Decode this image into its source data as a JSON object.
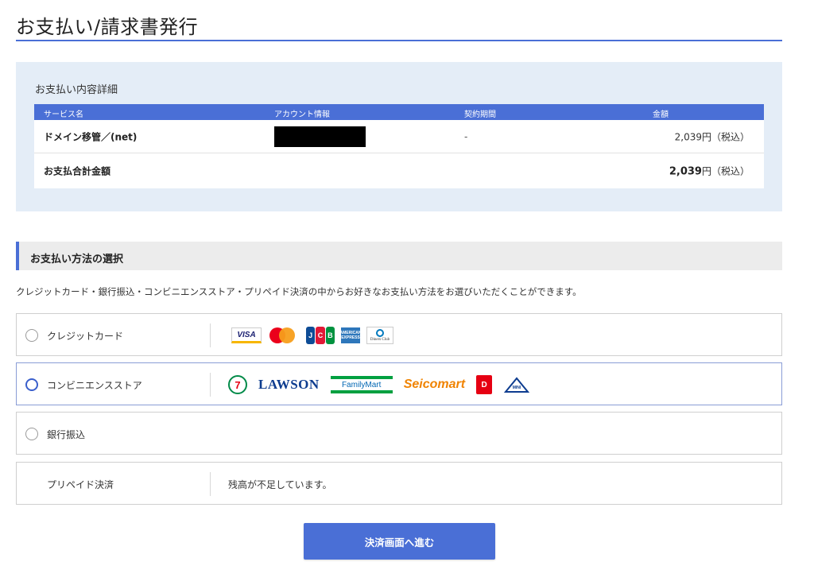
{
  "page": {
    "title": "お支払い/請求書発行"
  },
  "details": {
    "heading": "お支払い内容詳細",
    "columns": [
      "サービス名",
      "アカウント情報",
      "契約期間",
      "金額"
    ],
    "rows": [
      {
        "service": "ドメイン移管／(net)",
        "period": "-",
        "amount": "2,039円（税込）"
      }
    ],
    "total": {
      "label": "お支払合計金額",
      "amount_value": "2,039",
      "amount_unit": "円（税込）"
    }
  },
  "payment": {
    "section_title": "お支払い方法の選択",
    "description": "クレジットカード・銀行振込・コンビニエンスストア・プリペイド決済の中からお好きなお支払い方法をお選びいただくことができます。",
    "options": [
      {
        "label": "クレジットカード",
        "selected": false,
        "logos": [
          "visa-logo",
          "mastercard-logo",
          "jcb-logo",
          "amex-logo",
          "diners-club-logo"
        ]
      },
      {
        "label": "コンビニエンスストア",
        "selected": true,
        "logos": [
          "seven-eleven-logo",
          "lawson-logo",
          "familymart-logo",
          "seicomart-logo",
          "daily-yamazaki-logo",
          "ministop-logo"
        ]
      },
      {
        "label": "銀行振込",
        "selected": false
      },
      {
        "label": "プリペイド決済",
        "note": "残高が不足しています。"
      }
    ],
    "logo_text": {
      "visa": "VISA",
      "jcb": "JCB",
      "amex": "AMERICAN EXPRESS",
      "diners": "Diners Club",
      "seven": "7",
      "lawson": "LAWSON",
      "familymart": "FamilyMart",
      "seicomart": "Seicomart",
      "daily": "D",
      "ministop": "MINI STOP"
    }
  },
  "submit": {
    "label": "決済画面へ進む"
  },
  "colors": {
    "accent": "#4a6fd6",
    "panel_bg": "#e4edf7",
    "section_bg": "#ececec"
  }
}
